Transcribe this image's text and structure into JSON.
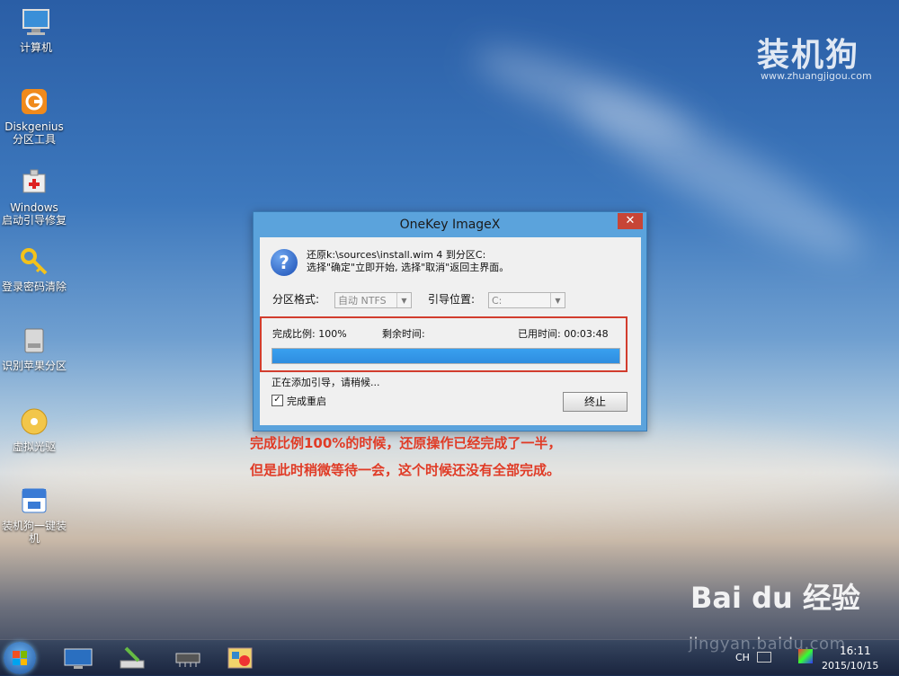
{
  "desktop": {
    "icons": [
      {
        "label": "计算机",
        "icon": "computer-icon"
      },
      {
        "label": "Diskgenius\n分区工具",
        "icon": "diskgenius-icon"
      },
      {
        "label": "Windows\n启动引导修复",
        "icon": "boot-repair-icon"
      },
      {
        "label": "登录密码清除",
        "icon": "key-icon"
      },
      {
        "label": "识别苹果分区",
        "icon": "drive-icon"
      },
      {
        "label": "虚拟光驱",
        "icon": "cd-icon"
      },
      {
        "label": "装机狗一键装\n机",
        "icon": "zhuangjigou-icon"
      }
    ],
    "brand": "装机狗",
    "brand_url": "www.zhuangjigou.com"
  },
  "dialog": {
    "title": "OneKey ImageX",
    "close": "✕",
    "message_line1": "还原k:\\sources\\install.wim 4 到分区C:",
    "message_line2": "选择\"确定\"立即开始, 选择\"取消\"返回主界面。",
    "partition_format_label": "分区格式:",
    "partition_format_value": "自动 NTFS",
    "boot_location_label": "引导位置:",
    "boot_location_value": "C:",
    "progress_label": "完成比例: 100%",
    "remaining_label": "剩余时间:",
    "elapsed_label": "已用时间: 00:03:48",
    "progress": 1.0,
    "status": "正在添加引导，请稍候...",
    "restart_label": "完成重启",
    "restart_checked": "✓",
    "stop_button": "终止"
  },
  "annotation": {
    "line1": "完成比例100%的时候，还原操作已经完成了一半，",
    "line2": "但是此时稍微等待一会，这个时候还没有全部完成。"
  },
  "watermark": {
    "baidu": "Bai du 经验",
    "url": "jingyan.baidu.com"
  },
  "taskbar": {
    "input_lang": "CH",
    "time": "16:11",
    "date": "2015/10/15"
  }
}
